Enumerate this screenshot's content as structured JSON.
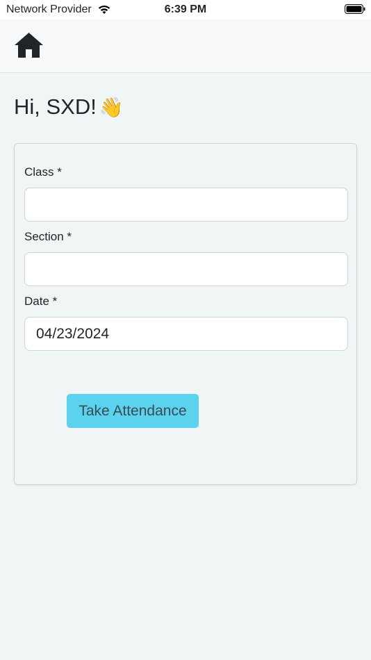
{
  "status": {
    "carrier": "Network Provider",
    "time": "6:39 PM"
  },
  "nav": {
    "home_icon": "home-icon"
  },
  "greeting": {
    "text": "Hi, SXD!",
    "emoji": "👋"
  },
  "form": {
    "class_label": "Class *",
    "class_value": "",
    "section_label": "Section *",
    "section_value": "",
    "date_label": "Date *",
    "date_value": "04/23/2024",
    "submit_label": "Take Attendance"
  },
  "colors": {
    "background": "#f0f5f5",
    "button": "#5bd3ef",
    "text": "#212529"
  }
}
